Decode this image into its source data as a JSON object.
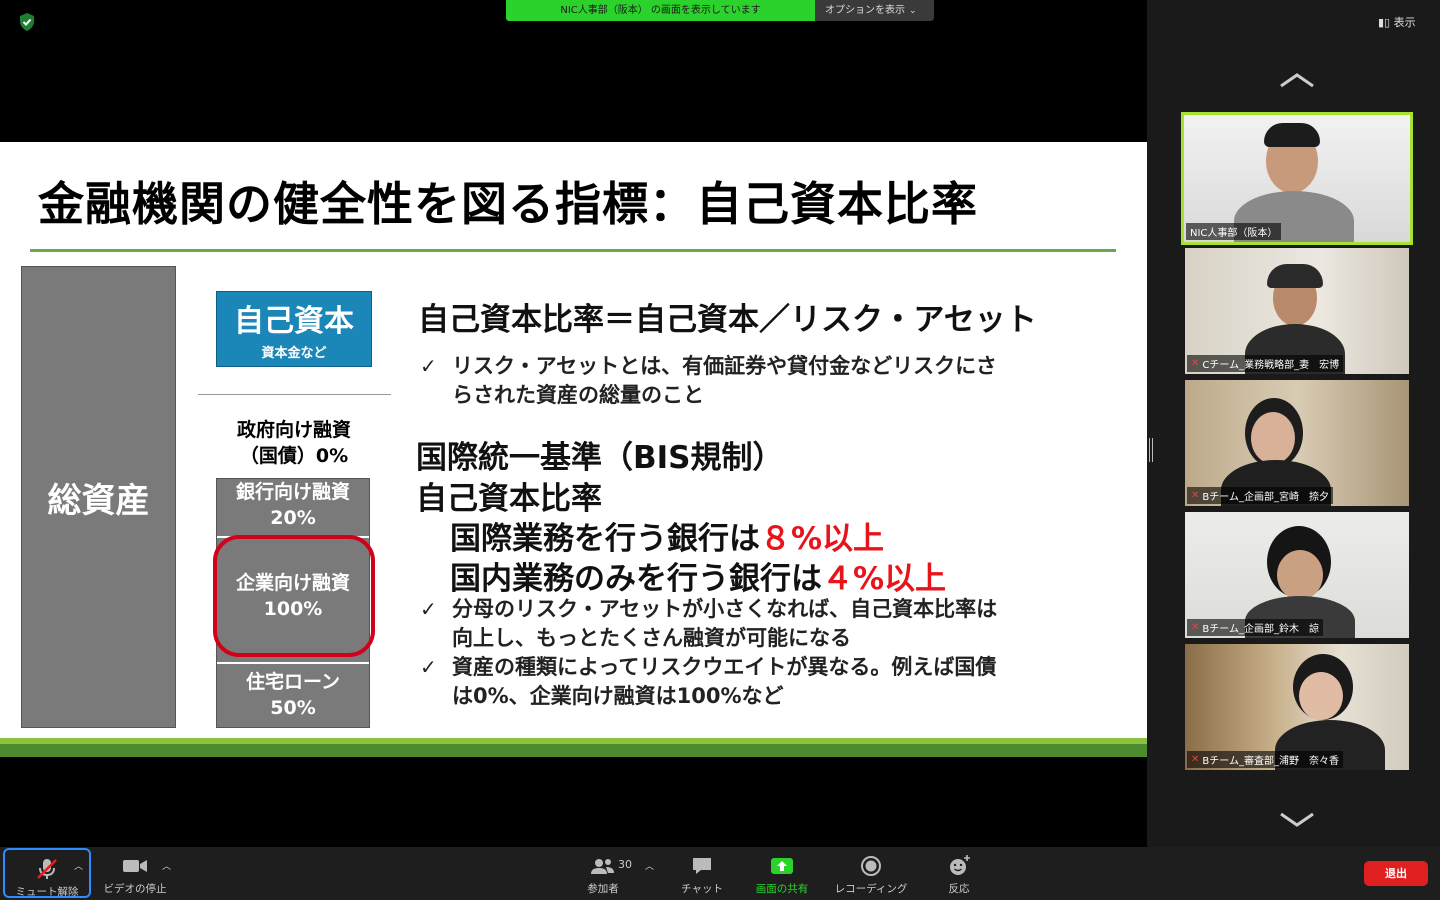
{
  "share_banner": {
    "status": "NIC人事部（阪本） の画面を表示しています",
    "options": "オプションを表示"
  },
  "view_button": "表示",
  "slide": {
    "title": "金融機関の健全性を図る指標：自己資本比率",
    "total_assets": "総資産",
    "equity_title": "自己資本",
    "equity_sub": "資本金など",
    "gov_line1": "政府向け融資",
    "gov_line2": "（国債）0%",
    "bank_line1": "銀行向け融資",
    "bank_line2": "20%",
    "corp_line1": "企業向け融資",
    "corp_line2": "100%",
    "housing_line1": "住宅ローン",
    "housing_line2": "50%",
    "formula": "自己資本比率＝自己資本／リスク・アセット",
    "check": "✓",
    "bullet1_line1": "リスク・アセットとは、有価証券や貸付金などリスクにさ",
    "bullet1_line2": "らされた資産の総量のこと",
    "bis_line1": "国際統一基準（BIS規制）",
    "bis_line2": "自己資本比率",
    "bis_line3_prefix": "国際業務を行う銀行は",
    "bis_line3_value": "８%以上",
    "bis_line4_prefix": "国内業務のみを行う銀行は",
    "bis_line4_value": "４%以上",
    "bullet2_line1": "分母のリスク・アセットが小さくなれば、自己資本比率は",
    "bullet2_line2": "向上し、もっとたくさん融資が可能になる",
    "bullet3_line1": "資産の種類によってリスクウエイトが異なる。例えば国債",
    "bullet3_line2": "は0%、企業向け融資は100%など"
  },
  "participants": [
    {
      "name": "NIC人事部（阪本）",
      "muted": false,
      "active": true
    },
    {
      "name": "Cチーム_業務戦略部_妻　宏博",
      "muted": true,
      "active": false
    },
    {
      "name": "Bチーム_企画部_宮崎　捺夕",
      "muted": true,
      "active": false
    },
    {
      "name": "Bチーム_企画部_鈴木　諒",
      "muted": true,
      "active": false
    },
    {
      "name": "Bチーム_審査部_浦野　奈々香",
      "muted": true,
      "active": false
    }
  ],
  "toolbar": {
    "unmute": "ミュート解除",
    "stop_video": "ビデオの停止",
    "participants_label": "参加者",
    "participants_count": "30",
    "chat": "チャット",
    "share_screen": "画面の共有",
    "record": "レコーディング",
    "reactions": "反応",
    "leave": "退出"
  },
  "colors": {
    "share_green": "#2bd22b",
    "active_tile_border": "#a6e22e",
    "highlight_red": "#d0021b",
    "equity_blue": "#1a87b8",
    "leave_red": "#e02020"
  }
}
